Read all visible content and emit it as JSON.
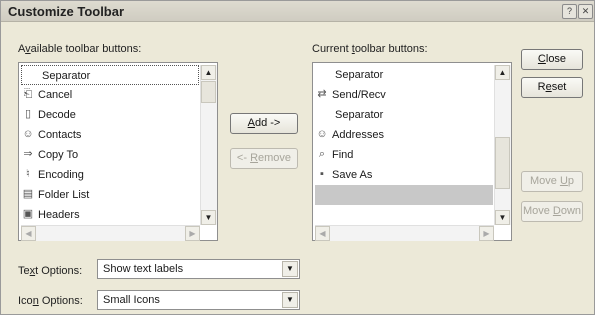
{
  "window": {
    "title": "Customize Toolbar",
    "help_glyph": "?",
    "close_glyph": "✕"
  },
  "available": {
    "label_prefix": "A",
    "label_underlined": "v",
    "label_rest": "ailable toolbar buttons:",
    "items": [
      {
        "label": "Separator",
        "icon": "separator-icon"
      },
      {
        "label": "Cancel",
        "icon": "cancel-icon"
      },
      {
        "label": "Decode",
        "icon": "decode-icon"
      },
      {
        "label": "Contacts",
        "icon": "contacts-icon"
      },
      {
        "label": "Copy To",
        "icon": "copy-to-icon"
      },
      {
        "label": "Encoding",
        "icon": "encoding-icon"
      },
      {
        "label": "Folder List",
        "icon": "folder-list-icon"
      },
      {
        "label": "Headers",
        "icon": "headers-icon"
      }
    ]
  },
  "current": {
    "label_prefix": "Current ",
    "label_underlined": "t",
    "label_rest": "oolbar buttons:",
    "items": [
      {
        "label": "Separator",
        "icon": "separator-icon"
      },
      {
        "label": "Send/Recv",
        "icon": "send-recv-icon"
      },
      {
        "label": "Separator",
        "icon": "separator-icon"
      },
      {
        "label": "Addresses",
        "icon": "addresses-icon"
      },
      {
        "label": "Find",
        "icon": "find-icon"
      },
      {
        "label": "Save As",
        "icon": "save-as-icon"
      },
      {
        "label": "",
        "icon": "",
        "selected": true
      }
    ]
  },
  "buttons": {
    "add_prefix": "",
    "add_underlined": "A",
    "add_rest": "dd ->",
    "remove_prefix": "<- ",
    "remove_underlined": "R",
    "remove_rest": "emove",
    "close_prefix": "",
    "close_underlined": "C",
    "close_rest": "lose",
    "reset_prefix": "R",
    "reset_underlined": "e",
    "reset_rest": "set",
    "move_up_prefix": "Move ",
    "move_up_underlined": "U",
    "move_up_rest": "p",
    "move_down_prefix": "Move ",
    "move_down_underlined": "D",
    "move_down_rest": "own"
  },
  "text_options": {
    "label_prefix": "Te",
    "label_underlined": "x",
    "label_rest": "t Options:",
    "value": "Show text labels"
  },
  "icon_options": {
    "label_prefix": "Ico",
    "label_underlined": "n",
    "label_rest": " Options:",
    "value": "Small Icons"
  }
}
